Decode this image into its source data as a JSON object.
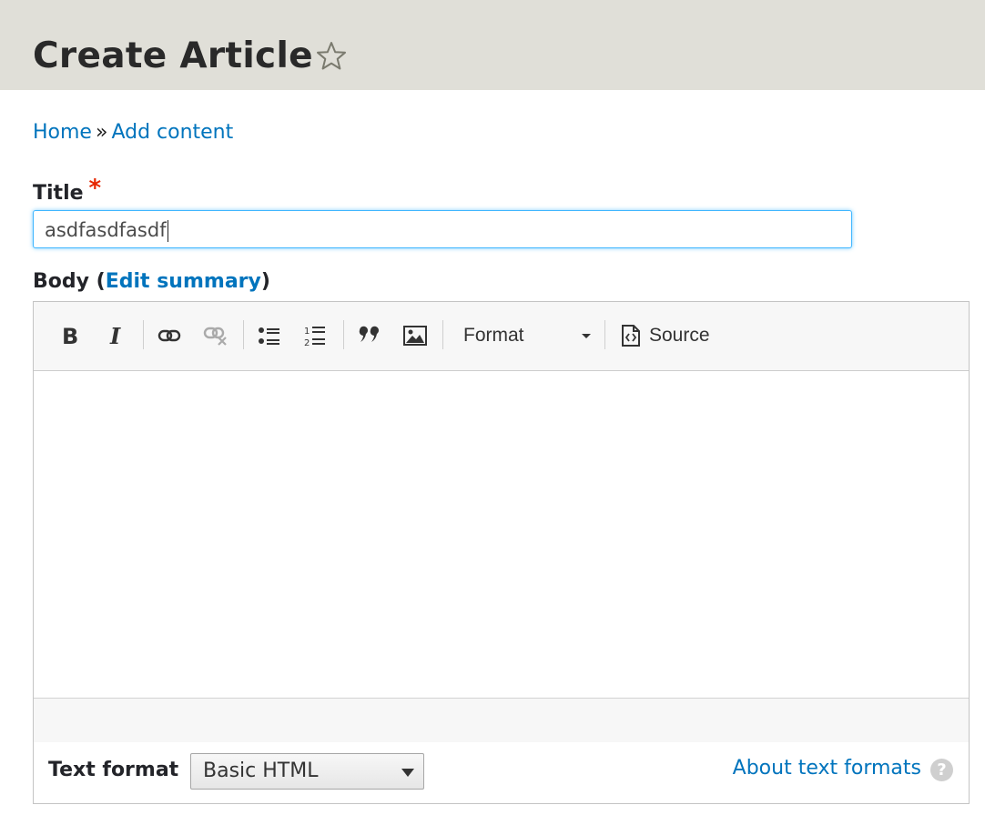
{
  "header": {
    "title": "Create Article"
  },
  "breadcrumb": {
    "items": [
      {
        "label": "Home"
      },
      {
        "label": "Add content"
      }
    ],
    "separator": "»"
  },
  "title_field": {
    "label": "Title",
    "required_marker": "*",
    "value": "asdfasdfasdf"
  },
  "body_field": {
    "label": "Body",
    "open_paren": "(",
    "edit_summary_label": "Edit summary",
    "close_paren": ")"
  },
  "toolbar": {
    "buttons": [
      {
        "icon": "bold-icon"
      },
      {
        "icon": "italic-icon"
      },
      {
        "icon": "link-icon"
      },
      {
        "icon": "unlink-icon"
      },
      {
        "icon": "bulleted-list-icon"
      },
      {
        "icon": "numbered-list-icon"
      },
      {
        "icon": "blockquote-icon"
      },
      {
        "icon": "image-icon"
      }
    ],
    "format_label": "Format",
    "source_label": "Source"
  },
  "text_format": {
    "label": "Text format",
    "selected": "Basic HTML",
    "about_link": "About text formats",
    "help_glyph": "?"
  },
  "colors": {
    "link": "#0074bd",
    "header_bg": "#e0dfd8",
    "focus_border": "#40b6ff",
    "required": "#e62600"
  }
}
